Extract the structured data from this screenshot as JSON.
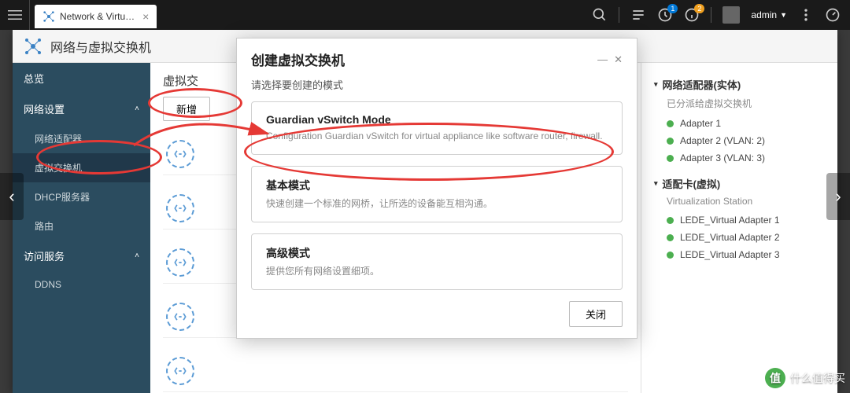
{
  "topbar": {
    "tab_title": "Network & Virtu…",
    "notif1_badge": "1",
    "notif2_badge": "2",
    "username": "admin"
  },
  "appheader": {
    "title": "网络与虚拟交换机"
  },
  "sidebar": {
    "overview": "总览",
    "netset": "网络设置",
    "adapter": "网络适配器",
    "vswitch": "虚拟交换机",
    "dhcp": "DHCP服务器",
    "route": "路由",
    "access": "访问服务",
    "ddns": "DDNS"
  },
  "main": {
    "title": "虚拟交",
    "add_label": "新增"
  },
  "rightpanel": {
    "sec1_title": "网络适配器(实体)",
    "sec1_sub": "已分派给虚拟交换机",
    "adapters": [
      "Adapter 1",
      "Adapter 2 (VLAN: 2)",
      "Adapter 3 (VLAN: 3)"
    ],
    "sec2_title": "适配卡(虚拟)",
    "sec2_sub": "Virtualization Station",
    "vadapters": [
      "LEDE_Virtual Adapter 1",
      "LEDE_Virtual Adapter 2",
      "LEDE_Virtual Adapter 3"
    ]
  },
  "modal": {
    "title": "创建虚拟交换机",
    "subtitle": "请选择要创建的模式",
    "modes": [
      {
        "title": "Guardian vSwitch Mode",
        "desc": "Configuration Guardian vSwitch for virtual appliance like software router, firewall."
      },
      {
        "title": "基本模式",
        "desc": "快速创建一个标准的网桥，让所选的设备能互相沟通。"
      },
      {
        "title": "高级模式",
        "desc": "提供您所有网络设置细项。"
      }
    ],
    "close_label": "关闭"
  },
  "watermark": "什么值得买"
}
